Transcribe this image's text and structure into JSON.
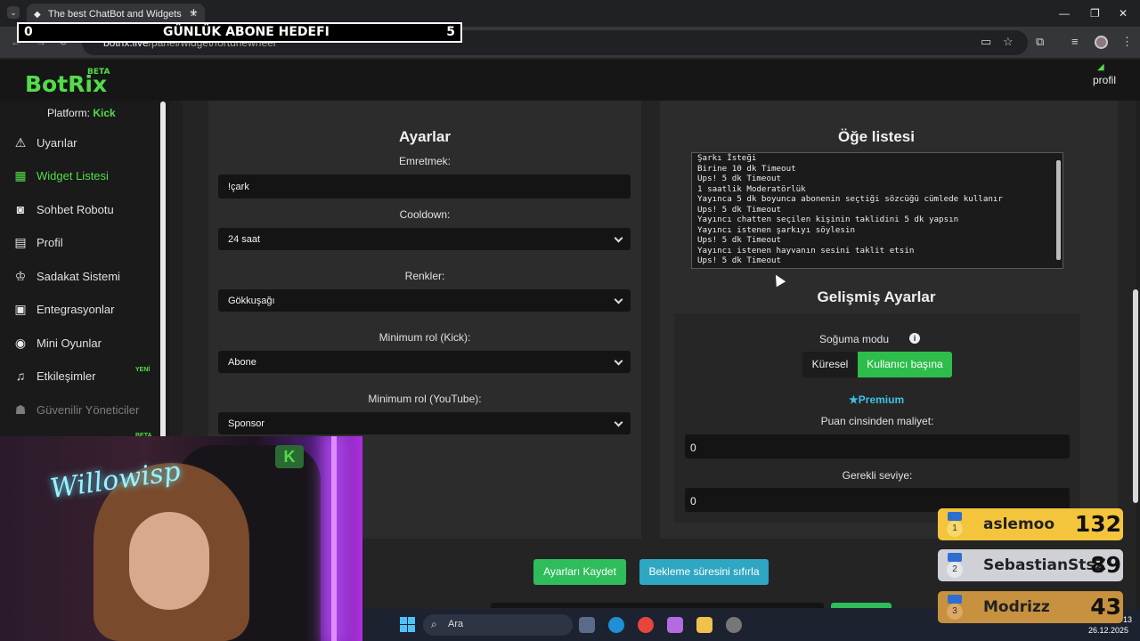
{
  "browser": {
    "tab_title": "The best ChatBot and Widgets",
    "url_host": "botrix.live",
    "url_path": "/panel/widget/fortunewheel"
  },
  "goal_bar": {
    "left": "0",
    "title": "GÜNLÜK ABONE HEDEFI",
    "right": "5"
  },
  "header": {
    "logo": "BotRix",
    "logo_badge": "BETA",
    "profile": "profil"
  },
  "sidebar": {
    "platform_label": "Platform:",
    "platform_value": "Kick",
    "items": [
      {
        "label": "Uyarılar",
        "icon": "warning-icon"
      },
      {
        "label": "Widget Listesi",
        "icon": "grid-icon"
      },
      {
        "label": "Sohbet Robotu",
        "icon": "robot-icon"
      },
      {
        "label": "Profil",
        "icon": "id-card-icon"
      },
      {
        "label": "Sadakat Sistemi",
        "icon": "trophy-icon"
      },
      {
        "label": "Entegrasyonlar",
        "icon": "integration-icon"
      },
      {
        "label": "Mini Oyunlar",
        "icon": "gamepad-icon"
      },
      {
        "label": "Etkileşimler",
        "icon": "music-icon"
      },
      {
        "label": "Güvenilir Yöneticiler",
        "icon": "users-icon"
      }
    ],
    "new_badge": "YENİ",
    "beta_badge": "BETA"
  },
  "settings": {
    "title": "Ayarlar",
    "command_label": "Emretmek:",
    "command_value": "!çark",
    "cooldown_label": "Cooldown:",
    "cooldown_value": "24 saat",
    "colors_label": "Renkler:",
    "colors_value": "Gökkuşağı",
    "minrole_kick_label": "Minimum rol (Kick):",
    "minrole_kick_value": "Abone",
    "minrole_yt_label": "Minimum rol (YouTube):",
    "minrole_yt_value": "Sponsor"
  },
  "items": {
    "title": "Öğe listesi",
    "lines": [
      "Şarkı İsteği",
      "Birine 10 dk Timeout",
      "Ups! 5 dk Timeout",
      "1 saatlik Moderatörlük",
      "Yayınca 5 dk boyunca abonenin seçtiği sözcüğü cümlede kullanır",
      "Ups! 5 dk Timeout",
      "Yayıncı chatten seçilen kişinin taklidini 5 dk yapsın",
      "Yayıncı istenen şarkıyı söylesin",
      "Ups! 5 dk Timeout",
      "Yayıncı istenen hayvanın sesini taklit etsin",
      "Ups! 5 dk Timeout"
    ]
  },
  "advanced": {
    "title": "Gelişmiş Ayarlar",
    "cooldown_mode_label": "Soğuma modu",
    "toggle_global": "Küresel",
    "toggle_per_user": "Kullanıcı başına",
    "premium_label": "Premium",
    "cost_label": "Puan cinsinden maliyet:",
    "cost_value": "0",
    "level_label": "Gerekli seviye:",
    "level_value": "0"
  },
  "actions": {
    "save": "Ayarları Kaydet",
    "reset": "Bekleme süresini sıfırla"
  },
  "leaderboard": [
    {
      "rank": "1",
      "name": "aslemoo",
      "score": "132",
      "color": "#f3c43c"
    },
    {
      "rank": "2",
      "name": "SebastianStsZ",
      "score": "89",
      "color": "#cfd1d6"
    },
    {
      "rank": "3",
      "name": "Modrizz",
      "score": "43",
      "color": "#c8913f"
    }
  ],
  "taskbar": {
    "search_placeholder": "Ara",
    "date": "26.12.2025",
    "time": "13"
  },
  "webcam": {
    "neon_sign": "Willowisp"
  },
  "colors": {
    "accent_green": "#53dc4a",
    "button_green": "#2ebd5a",
    "button_teal": "#2fa7c2",
    "premium_blue": "#3ec3e6"
  }
}
